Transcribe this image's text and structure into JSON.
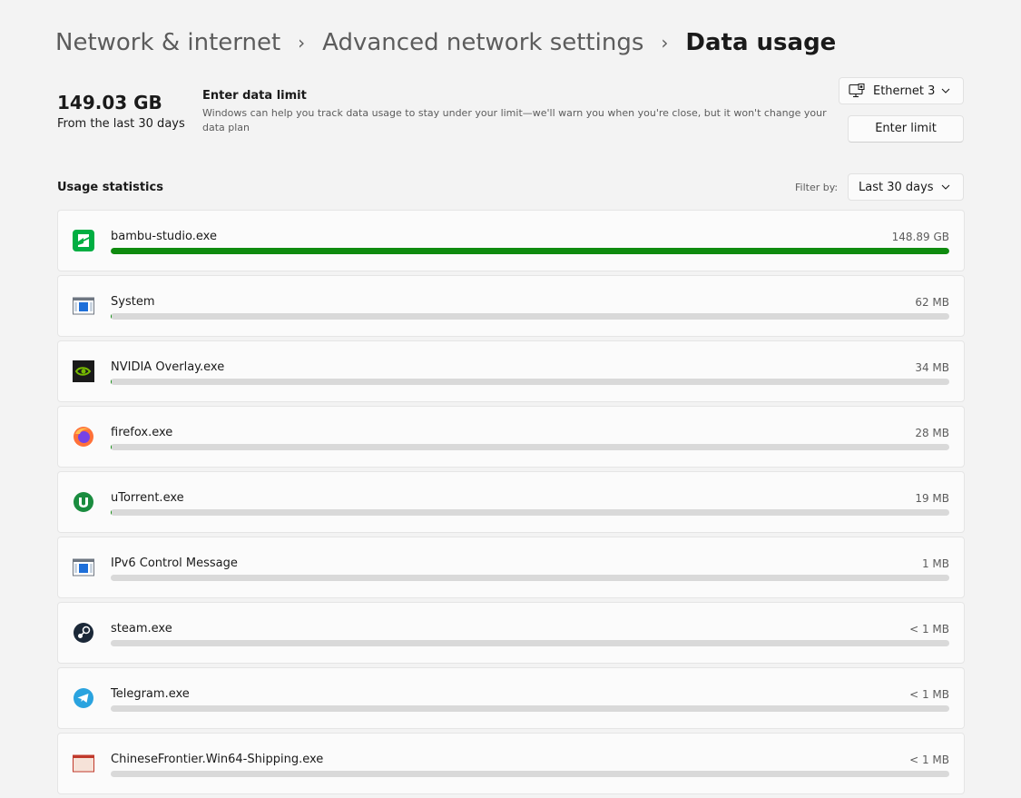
{
  "breadcrumb": {
    "items": [
      "Network & internet",
      "Advanced network settings"
    ],
    "current": "Data usage",
    "separator": "›"
  },
  "summary": {
    "total": "149.03 GB",
    "period": "From the last 30 days"
  },
  "data_limit": {
    "title": "Enter data limit",
    "description": "Windows can help you track data usage to stay under your limit—we'll warn you when you're close, but it won't change your data plan",
    "button_label": "Enter limit"
  },
  "adapter": {
    "selected": "Ethernet 3",
    "icon": "ethernet-monitor-icon"
  },
  "usage": {
    "title": "Usage statistics",
    "filter_label": "Filter by:",
    "filter_selected": "Last 30 days",
    "bar_color": "#0f8b0f",
    "apps": [
      {
        "name": "bambu-studio.exe",
        "amount": "148.89 GB",
        "icon": "bambu-studio-icon",
        "fraction": 1.0
      },
      {
        "name": "System",
        "amount": "62 MB",
        "icon": "system-window-icon",
        "fraction": 0.0004
      },
      {
        "name": "NVIDIA Overlay.exe",
        "amount": "34 MB",
        "icon": "nvidia-icon",
        "fraction": 0.0002
      },
      {
        "name": "firefox.exe",
        "amount": "28 MB",
        "icon": "firefox-icon",
        "fraction": 0.0002
      },
      {
        "name": "uTorrent.exe",
        "amount": "19 MB",
        "icon": "utorrent-icon",
        "fraction": 0.0001
      },
      {
        "name": "IPv6 Control Message",
        "amount": "1 MB",
        "icon": "system-window-icon",
        "fraction": 0.0
      },
      {
        "name": "steam.exe",
        "amount": "< 1 MB",
        "icon": "steam-icon",
        "fraction": 0.0
      },
      {
        "name": "Telegram.exe",
        "amount": "< 1 MB",
        "icon": "telegram-icon",
        "fraction": 0.0
      },
      {
        "name": "ChineseFrontier.Win64-Shipping.exe",
        "amount": "< 1 MB",
        "icon": "game-icon",
        "fraction": 0.0
      }
    ]
  }
}
